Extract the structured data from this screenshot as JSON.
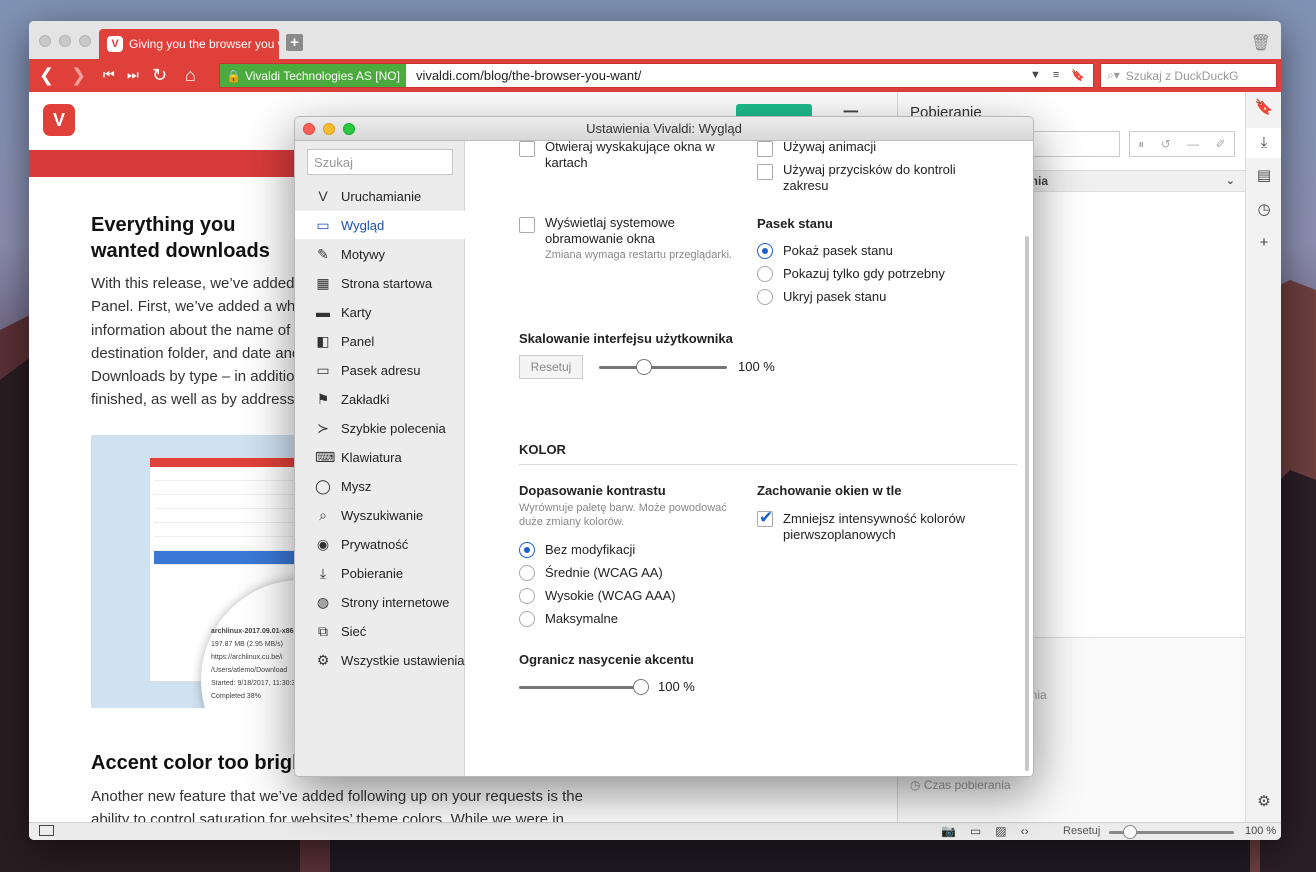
{
  "tab": {
    "title": "Giving you the browser you w"
  },
  "address": {
    "certificate": "Vivaldi Technologies AS [NO]",
    "url": "vivaldi.com/blog/the-browser-you-want/",
    "search_placeholder": "Szukaj z DuckDuckG"
  },
  "page": {
    "logo_letter": "V",
    "article1_title": "Everything you wanted downloads",
    "article1_lines": [
      "With this release, we’ve added s",
      "Panel. First, we’ve added a who",
      "information about the name of t",
      "destination folder, and date and",
      "Downloads by type – in addition",
      "finished, as well as by address."
    ],
    "image_caption": "archlinux-2017.09.01-x86_6",
    "image_lines": [
      "197.87 MB (2.95 MB/s)",
      "https://archlinux.cu.be/i",
      "/Users/atlemo/Download",
      "Started: 9/18/2017, 11:30:3",
      "Completed 38%"
    ],
    "article2_title": "Accent color too brigh",
    "article2_lines": [
      "Another new feature that we’ve added following up on your requests is the",
      "ability to control saturation for websites’ theme colors. While we were in"
    ]
  },
  "panel": {
    "title": "Pobieranie",
    "column_header": "ania",
    "lower_text1": "ania",
    "lower_text2": "Czas pobierania"
  },
  "statusbar": {
    "reset": "Resetuj",
    "zoom": "100 %"
  },
  "settings": {
    "title": "Ustawienia Vivaldi: Wygląd",
    "search_placeholder": "Szukaj",
    "sidebar": [
      {
        "label": "Uruchamianie",
        "icon": "V"
      },
      {
        "label": "Wygląd",
        "icon": "▭"
      },
      {
        "label": "Motywy",
        "icon": "✎"
      },
      {
        "label": "Strona startowa",
        "icon": "▦"
      },
      {
        "label": "Karty",
        "icon": "▬"
      },
      {
        "label": "Panel",
        "icon": "◧"
      },
      {
        "label": "Pasek adresu",
        "icon": "▭"
      },
      {
        "label": "Zakładki",
        "icon": "⚑"
      },
      {
        "label": "Szybkie polecenia",
        "icon": "≻"
      },
      {
        "label": "Klawiatura",
        "icon": "⌨"
      },
      {
        "label": "Mysz",
        "icon": "◯"
      },
      {
        "label": "Wyszukiwanie",
        "icon": "⌕"
      },
      {
        "label": "Prywatność",
        "icon": "◉"
      },
      {
        "label": "Pobieranie",
        "icon": "⤓"
      },
      {
        "label": "Strony internetowe",
        "icon": "◍"
      },
      {
        "label": "Sieć",
        "icon": "⧉"
      },
      {
        "label": "Wszystkie ustawienia",
        "icon": "⚙"
      }
    ],
    "opt_popups": "Otwieraj wyskakujące okna w kartach",
    "opt_animations": "Używaj animacji",
    "opt_range_buttons": "Używaj przycisków do kontroli zakresu",
    "opt_system_frame": "Wyświetlaj systemowe obramowanie okna",
    "opt_system_frame_hint": "Zmiana wymaga restartu przeglądarki.",
    "status_heading": "Pasek stanu",
    "status_options": [
      "Pokaż pasek stanu",
      "Pokazuj tylko gdy potrzebny",
      "Ukryj pasek stanu"
    ],
    "scaling_heading": "Skalowanie interfejsu użytkownika",
    "scaling_reset": "Resetuj",
    "scaling_value": "100 %",
    "scaling_fraction": 0.35,
    "color_heading": "KOLOR",
    "contrast_heading": "Dopasowanie kontrastu",
    "contrast_hint": "Wyrównuje paletę barw. Może powodować duże zmiany kolorów.",
    "contrast_options": [
      "Bez modyfikacji",
      "Średnie (WCAG AA)",
      "Wysokie (WCAG AAA)",
      "Maksymalne"
    ],
    "bg_heading": "Zachowanie okien w tle",
    "bg_option": "Zmniejsz intensywność kolorów pierwszoplanowych",
    "accent_heading": "Ogranicz nasycenie akcentu",
    "accent_value": "100 %",
    "accent_fraction": 1.0
  },
  "colors": {
    "accent": "#e0403a",
    "selected": "#1a5fd4"
  }
}
